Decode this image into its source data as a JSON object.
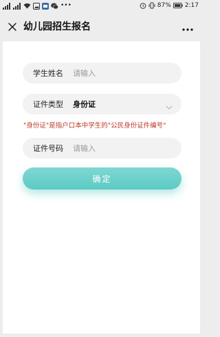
{
  "status_bar": {
    "battery": "87%",
    "time": "2:17"
  },
  "nav": {
    "title": "幼儿园招生报名",
    "close_icon": "close-icon",
    "more_icon": "more-horizontal-icon"
  },
  "form": {
    "student_name": {
      "label": "学生姓名",
      "placeholder": "请输入",
      "value": ""
    },
    "id_type": {
      "label": "证件类型",
      "value": "身份证",
      "icon": "chevron-down-icon"
    },
    "hint": "\"身份证\"是指户口本中学生的\"公民身份证件编号\"",
    "id_number": {
      "label": "证件号码",
      "placeholder": "请输入",
      "value": ""
    },
    "submit_label": "确定"
  },
  "colors": {
    "accent": "#5ccac4",
    "hint": "#c0392b",
    "field_bg": "#f2f2f2",
    "page_bg": "#ededed"
  }
}
